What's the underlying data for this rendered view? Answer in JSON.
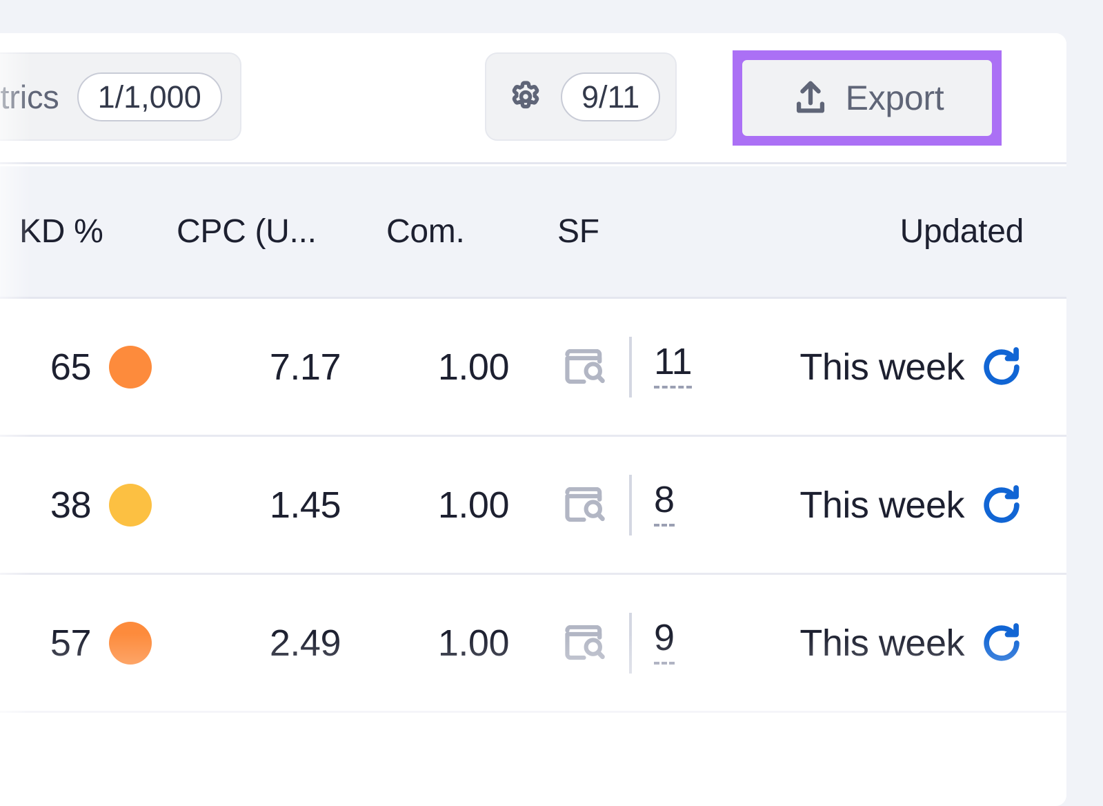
{
  "toolbar": {
    "update_metrics": {
      "label": "date metrics",
      "count": "1/1,000",
      "icon": "update-metrics-icon"
    },
    "settings": {
      "icon": "gear-icon",
      "count": "9/11"
    },
    "export": {
      "label": "Export",
      "icon": "upload-icon",
      "highlight_color": "#ab70f5"
    }
  },
  "table": {
    "columns": [
      {
        "key": "kd",
        "label": "KD %"
      },
      {
        "key": "cpc",
        "label": "CPC (U..."
      },
      {
        "key": "com",
        "label": "Com."
      },
      {
        "key": "sf",
        "label": "SF"
      },
      {
        "key": "updated",
        "label": "Updated"
      }
    ],
    "rows": [
      {
        "kd": "65",
        "kd_color": "#fd8b3c",
        "cpc": "7.17",
        "com": "1.00",
        "sf_icon": "serp-preview-icon",
        "sf": "11",
        "updated": "This week",
        "refresh_icon": "refresh-icon",
        "refresh_color": "#1165d4"
      },
      {
        "kd": "38",
        "kd_color": "#fcc042",
        "cpc": "1.45",
        "com": "1.00",
        "sf_icon": "serp-preview-icon",
        "sf": "8",
        "updated": "This week",
        "refresh_icon": "refresh-icon",
        "refresh_color": "#1165d4"
      },
      {
        "kd": "57",
        "kd_color": "#fd8b3c",
        "cpc": "2.49",
        "com": "1.00",
        "sf_icon": "serp-preview-icon",
        "sf": "9",
        "updated": "This week",
        "refresh_icon": "refresh-icon",
        "refresh_color": "#1165d4"
      }
    ]
  }
}
